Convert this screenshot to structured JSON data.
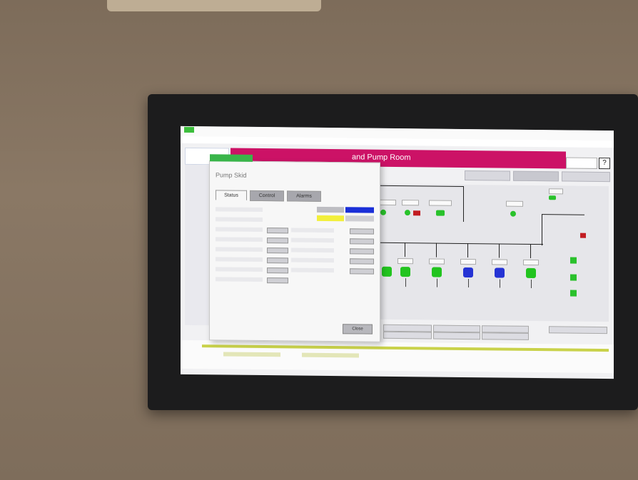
{
  "header": {
    "title": "and Pump Room"
  },
  "dialog": {
    "title": "Pump Skid",
    "tabs": [
      {
        "label": "Status"
      },
      {
        "label": "Control"
      },
      {
        "label": "Alarms"
      }
    ],
    "close_label": "Close"
  },
  "colors": {
    "header_bar": "#cc1266",
    "pump_running": "#22c41f",
    "pump_stopped": "#2533d4",
    "indicator_blue": "#1a2fd8",
    "indicator_yellow": "#f2ef3c",
    "alarm_red": "#c21c22",
    "window_tag": "#39b54a"
  },
  "icons": [
    "pump-icon",
    "valve-icon",
    "help-icon",
    "alarm-pump-icon"
  ]
}
